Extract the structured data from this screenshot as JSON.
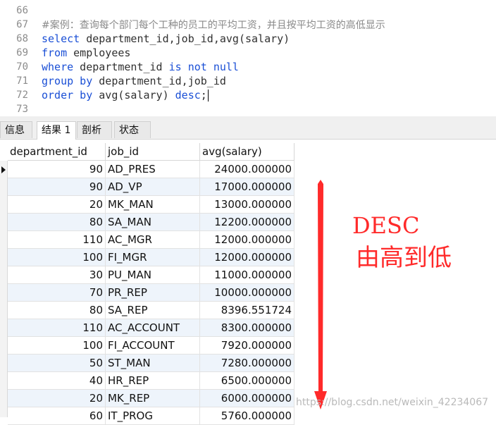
{
  "editor": {
    "lines": [
      {
        "num": "66",
        "segments": []
      },
      {
        "num": "67",
        "segments": [
          {
            "cls": "cm",
            "text": "#案例：查询每个部门每个工种的员工的平均工资，并且按平均工资的高低显示"
          }
        ]
      },
      {
        "num": "68",
        "segments": [
          {
            "cls": "kw",
            "text": "select"
          },
          {
            "cls": "tx",
            "text": " department_id,job_id,avg(salary)"
          }
        ]
      },
      {
        "num": "69",
        "segments": [
          {
            "cls": "kw",
            "text": "from"
          },
          {
            "cls": "tx",
            "text": " employees"
          }
        ]
      },
      {
        "num": "70",
        "segments": [
          {
            "cls": "kw",
            "text": "where"
          },
          {
            "cls": "tx",
            "text": " department_id "
          },
          {
            "cls": "kw",
            "text": "is not null"
          }
        ]
      },
      {
        "num": "71",
        "segments": [
          {
            "cls": "kw",
            "text": "group by"
          },
          {
            "cls": "tx",
            "text": " department_id,job_id"
          }
        ]
      },
      {
        "num": "72",
        "segments": [
          {
            "cls": "kw",
            "text": "order by"
          },
          {
            "cls": "tx",
            "text": " avg(salary) "
          },
          {
            "cls": "kw",
            "text": "desc"
          },
          {
            "cls": "tx",
            "text": ";"
          }
        ]
      },
      {
        "num": "73",
        "segments": []
      }
    ]
  },
  "tabs": [
    {
      "label": "信息",
      "active": false
    },
    {
      "label": "结果 1",
      "active": true
    },
    {
      "label": "剖析",
      "active": false
    },
    {
      "label": "状态",
      "active": false
    }
  ],
  "grid": {
    "columns": [
      "department_id",
      "job_id",
      "avg(salary)"
    ],
    "rows": [
      [
        "90",
        "AD_PRES",
        "24000.000000"
      ],
      [
        "90",
        "AD_VP",
        "17000.000000"
      ],
      [
        "20",
        "MK_MAN",
        "13000.000000"
      ],
      [
        "80",
        "SA_MAN",
        "12200.000000"
      ],
      [
        "110",
        "AC_MGR",
        "12000.000000"
      ],
      [
        "100",
        "FI_MGR",
        "12000.000000"
      ],
      [
        "30",
        "PU_MAN",
        "11000.000000"
      ],
      [
        "70",
        "PR_REP",
        "10000.000000"
      ],
      [
        "80",
        "SA_REP",
        "8396.551724"
      ],
      [
        "110",
        "AC_ACCOUNT",
        "8300.000000"
      ],
      [
        "100",
        "FI_ACCOUNT",
        "7920.000000"
      ],
      [
        "50",
        "ST_MAN",
        "7280.000000"
      ],
      [
        "40",
        "HR_REP",
        "6500.000000"
      ],
      [
        "20",
        "MK_REP",
        "6000.000000"
      ],
      [
        "60",
        "IT_PROG",
        "5760.000000"
      ]
    ]
  },
  "annotation": {
    "line1": "DESC",
    "line2": "由高到低",
    "color": "#ff2a2a"
  },
  "watermark": "https://blog.csdn.net/weixin_42234067"
}
